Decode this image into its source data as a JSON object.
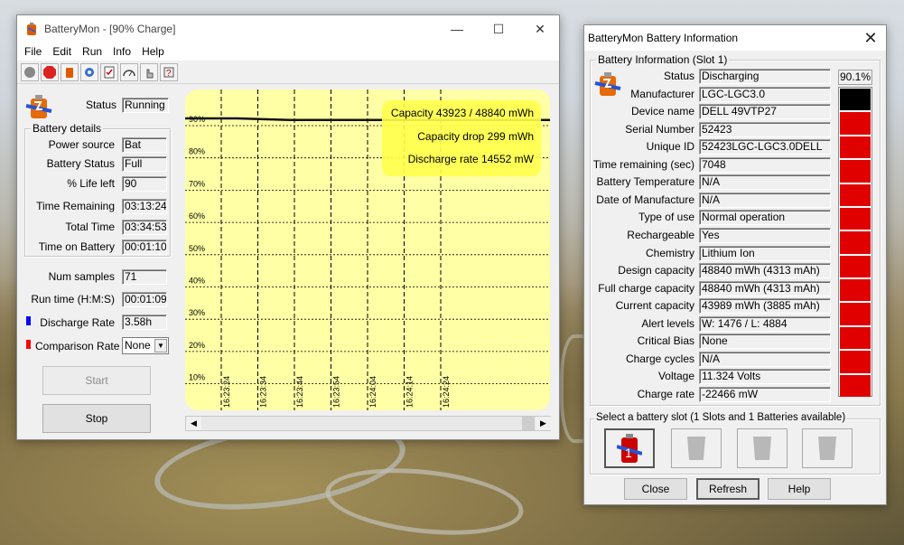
{
  "main": {
    "title": "BatteryMon - [90% Charge]",
    "menu": [
      "File",
      "Edit",
      "Run",
      "Info",
      "Help"
    ],
    "status_label": "Status",
    "status_value": "Running",
    "details_group": "Battery details",
    "fields": [
      {
        "label": "Power source",
        "value": "Bat"
      },
      {
        "label": "Battery Status",
        "value": "Full"
      },
      {
        "label": "% Life left",
        "value": "90"
      },
      {
        "label": "Time Remaining",
        "value": "03:13:24"
      },
      {
        "label": "Total Time",
        "value": "03:34:53"
      },
      {
        "label": "Time on Battery",
        "value": "00:01:10"
      }
    ],
    "num_samples_label": "Num samples",
    "num_samples_value": "71",
    "run_time_label": "Run time (H:M:S)",
    "run_time_value": "00:01:09",
    "discharge_rate_label": "Discharge Rate",
    "discharge_rate_value": "3.58h",
    "comparison_rate_label": "Comparison Rate",
    "comparison_rate_value": "None",
    "start_label": "Start",
    "stop_label": "Stop",
    "colors": {
      "discharge": "#0000ff",
      "comparison": "#ff0000",
      "chart_bg": "#ffffa6"
    }
  },
  "chart_data": {
    "type": "line",
    "y_tick_labels": [
      "90%",
      "80%",
      "70%",
      "60%",
      "50%",
      "40%",
      "30%",
      "20%",
      "10%"
    ],
    "x_tick_labels": [
      "16:23:24",
      "16:23:34",
      "16:23:44",
      "16:23:54",
      "16:24:04",
      "16:24:14",
      "16:24:24"
    ],
    "ylim": [
      0,
      100
    ],
    "series": [
      {
        "x": [
          0,
          10,
          20,
          30,
          40,
          50,
          60,
          70
        ],
        "values": [
          90,
          90,
          89.5,
          89.5,
          89.5,
          89.5,
          89.5,
          89.5
        ]
      }
    ],
    "annotations": [
      "Capacity 43923 / 48840 mWh",
      "Capacity drop 299 mWh",
      "Discharge rate 14552 mW"
    ]
  },
  "info": {
    "title": "BatteryMon Battery Information",
    "group": "Battery Information (Slot 1)",
    "percent": "90.1%",
    "fill_fraction": 0.901,
    "rows": [
      {
        "label": "Status",
        "value": "Discharging"
      },
      {
        "label": "Manufacturer",
        "value": "LGC-LGC3.0"
      },
      {
        "label": "Device name",
        "value": "DELL 49VTP27"
      },
      {
        "label": "Serial Number",
        "value": "52423"
      },
      {
        "label": "Unique ID",
        "value": "52423LGC-LGC3.0DELL"
      },
      {
        "label": "Time remaining (sec)",
        "value": "7048"
      },
      {
        "label": "Battery Temperature",
        "value": "N/A"
      },
      {
        "label": "Date of Manufacture",
        "value": "N/A"
      },
      {
        "label": "Type of use",
        "value": "Normal operation"
      },
      {
        "label": "Rechargeable",
        "value": "Yes"
      },
      {
        "label": "Chemistry",
        "value": "Lithium Ion"
      },
      {
        "label": "Design capacity",
        "value": "48840 mWh (4313 mAh)"
      },
      {
        "label": "Full charge capacity",
        "value": "48840 mWh (4313 mAh)"
      },
      {
        "label": "Current capacity",
        "value": "43989 mWh (3885 mAh)"
      },
      {
        "label": "Alert levels",
        "value": "W: 1476 / L: 4884"
      },
      {
        "label": "Critical Bias",
        "value": "None"
      },
      {
        "label": "Charge cycles",
        "value": "N/A"
      },
      {
        "label": "Voltage",
        "value": "11.324 Volts"
      },
      {
        "label": "Charge rate",
        "value": "-22466 mW"
      }
    ],
    "slot_group": "Select a battery slot (1 Slots and 1 Batteries available)",
    "close_label": "Close",
    "refresh_label": "Refresh",
    "help_label": "Help",
    "colors": {
      "gauge_fill": "#e00000",
      "gauge_empty": "#000000"
    }
  }
}
